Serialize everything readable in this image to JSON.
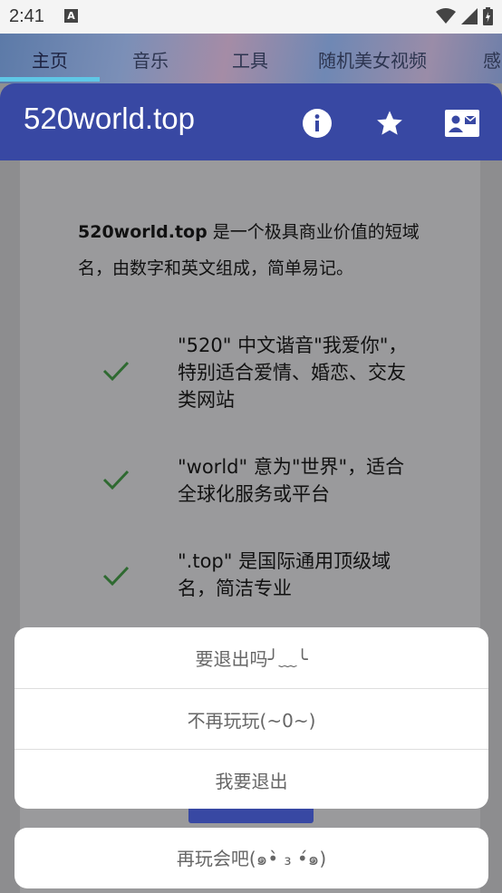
{
  "status": {
    "time": "2:41",
    "notification_glyph": "A"
  },
  "tabs": [
    {
      "label": "主页",
      "active": true
    },
    {
      "label": "音乐",
      "active": false
    },
    {
      "label": "工具",
      "active": false
    },
    {
      "label": "随机美女视频",
      "active": false
    },
    {
      "label": "感",
      "active": false
    }
  ],
  "toolbar": {
    "title": "520world.top",
    "icons": [
      "info-icon",
      "star-icon",
      "contact-mail-icon"
    ]
  },
  "intro": {
    "domain": "520world.top",
    "text": " 是一个极具商业价值的短域名，由数字和英文组成，简单易记。"
  },
  "features": [
    {
      "text": "\"520\" 中文谐音\"我爱你\"，特别适合爱情、婚恋、交友类网站"
    },
    {
      "text": "\"world\" 意为\"世界\"，适合全球化服务或平台"
    },
    {
      "text": "\".top\" 是国际通用顶级域名，简洁专业"
    }
  ],
  "sheet": {
    "title": "要退出吗╯﹏╰",
    "option_stay": "不再玩玩(~0~)",
    "option_exit": "我要退出",
    "cancel": "再玩会吧(๑•̀ ₃ •́๑)"
  },
  "colors": {
    "primary": "#3848a3",
    "accent": "#5fc7e6",
    "check": "#4caf50"
  }
}
